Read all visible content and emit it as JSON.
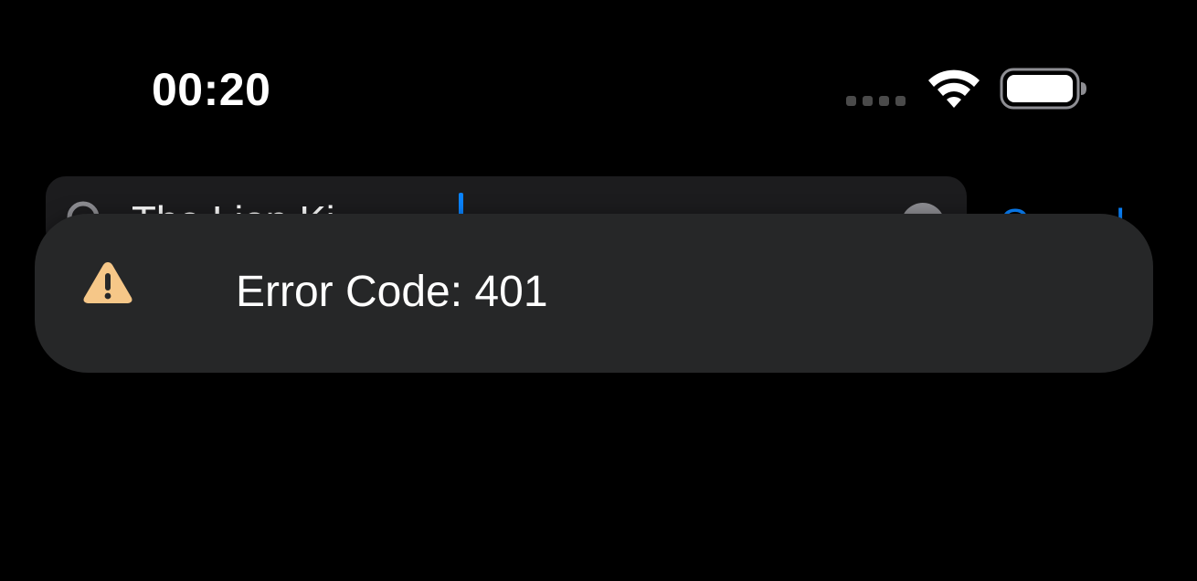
{
  "status_bar": {
    "time": "00:20",
    "wifi_icon": "wifi-icon",
    "battery_icon": "battery-icon",
    "signal_icon": "cellular-signal-dots-icon"
  },
  "search": {
    "query": "The Lion Ki",
    "cancel_label": "Cancel",
    "accent_color": "#0a84ff"
  },
  "toast": {
    "icon": "warning-icon",
    "message": "Error Code: 401",
    "icon_color": "#f6c788"
  }
}
